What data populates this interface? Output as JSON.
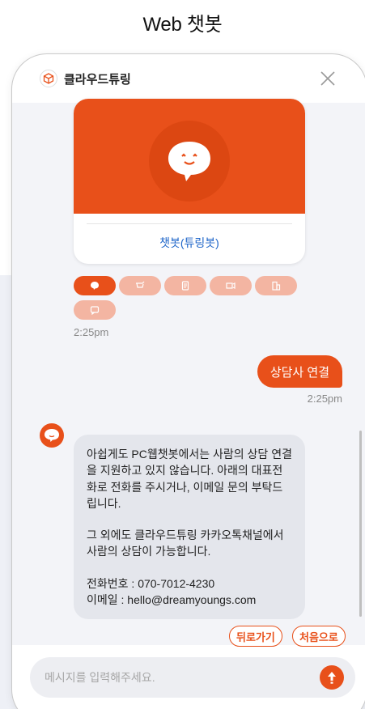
{
  "page": {
    "title": "Web 챗봇"
  },
  "header": {
    "brand_name": "클라우드튜링",
    "brand_icon": "cube-icon",
    "close_icon": "close-icon"
  },
  "card": {
    "label": "챗봇(튜링봇)",
    "avatar_icon": "speech-face-icon",
    "accent": "#e8501a"
  },
  "chips": [
    {
      "icon": "chat-icon",
      "active": true
    },
    {
      "icon": "cart-icon",
      "active": false
    },
    {
      "icon": "document-icon",
      "active": false
    },
    {
      "icon": "device-icon",
      "active": false
    },
    {
      "icon": "building-icon",
      "active": false
    },
    {
      "icon": "message-icon",
      "active": false
    }
  ],
  "messages": {
    "time_1": "2:25pm",
    "user_text": "상담사 연결",
    "time_2": "2:25pm",
    "bot_para_1": "아쉽게도 PC웹챗봇에서는 사람의 상담 연결을 지원하고 있지 않습니다. 아래의 대표전화로 전화를 주시거나, 이메일 문의 부탁드립니다.",
    "bot_para_2": "그 외에도 클라우드튜링 카카오톡채널에서 사람의 상담이 가능합니다.",
    "bot_phone": "전화번호 : 070-7012-4230",
    "bot_email": "이메일 : hello@dreamyoungs.com"
  },
  "quick_replies": {
    "back": "뒤로가기",
    "home": "처음으로"
  },
  "input": {
    "placeholder": "메시지를 입력해주세요.",
    "value": "",
    "send_icon": "arrow-up-icon"
  },
  "colors": {
    "accent": "#e8501a",
    "accent_light": "#f3b5a2",
    "bubble_gray": "#e4e6ec",
    "link_blue": "#1f66c9"
  }
}
